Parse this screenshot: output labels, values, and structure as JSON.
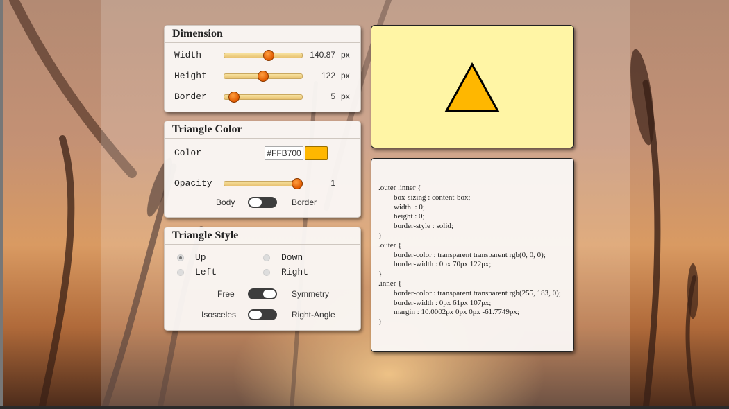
{
  "dimension": {
    "title": "Dimension",
    "rows": [
      {
        "label": "Width",
        "value": "140.87",
        "unit": "px",
        "fraction": 0.56
      },
      {
        "label": "Height",
        "value": "122",
        "unit": "px",
        "fraction": 0.49
      },
      {
        "label": "Border",
        "value": "5",
        "unit": "px",
        "fraction": 0.12
      }
    ]
  },
  "color": {
    "title": "Triangle Color",
    "color_label": "Color",
    "hex": "#FFB700",
    "opacity_label": "Opacity",
    "opacity_value": "1",
    "opacity_fraction": 0.93,
    "toggle_left": "Body",
    "toggle_right": "Border",
    "swatch_hex": "#FFB700"
  },
  "style": {
    "title": "Triangle Style",
    "radios": [
      {
        "label": "Up",
        "checked": true
      },
      {
        "label": "Down",
        "checked": false
      },
      {
        "label": "Left",
        "checked": false
      },
      {
        "label": "Right",
        "checked": false
      }
    ],
    "toggle1_left": "Free",
    "toggle1_right": "Symmetry",
    "toggle2_left": "Isosceles",
    "toggle2_right": "Right-Angle"
  },
  "preview": {
    "background": "#FFF5A5",
    "fill": "#FFB700",
    "stroke": "#000000"
  },
  "code_lines": [
    ".outer .inner {",
    "        box-sizing : content-box;",
    "        width  : 0;",
    "        height : 0;",
    "        border-style : solid;",
    "}",
    ".outer {",
    "        border-color : transparent transparent rgb(0, 0, 0);",
    "        border-width : 0px 70px 122px;",
    "}",
    ".inner {",
    "        border-color : transparent transparent rgb(255, 183, 0);",
    "        border-width : 0px 61px 107px;",
    "        margin : 10.0002px 0px 0px -61.7749px;",
    "}"
  ]
}
